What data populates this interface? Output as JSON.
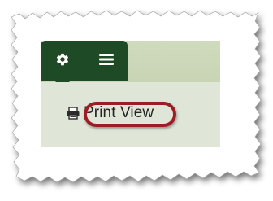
{
  "toolbar": {
    "gear_icon": "gear-icon",
    "menu_icon": "hamburger-menu-icon",
    "accent_color": "#1f4a26"
  },
  "menu": {
    "items": [
      {
        "icon": "printer-icon",
        "label": "Print View"
      }
    ],
    "highlight_color": "#9d1d24"
  }
}
